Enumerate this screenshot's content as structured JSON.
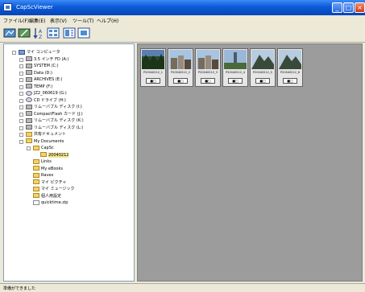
{
  "window": {
    "title": "CapScViewer"
  },
  "menu": [
    "ファイル(F)",
    "編集(E)",
    "表示(V)",
    "ツール(T)",
    "ヘルプ(H)"
  ],
  "toolbar": [
    {
      "icon": "view-icon"
    },
    {
      "icon": "edit-icon"
    },
    {
      "icon": "sort-icon"
    },
    {
      "icon": "thumbnail-view-icon"
    },
    {
      "icon": "list-view-icon"
    },
    {
      "icon": "slideshow-icon"
    }
  ],
  "tree": [
    {
      "label": "マイ コンピュータ",
      "icon": "comp",
      "expander": true
    },
    {
      "label": "3.5 インチ FD (A:)",
      "icon": "drive",
      "expander": true
    },
    {
      "label": "SYSTEM (C:)",
      "icon": "drive",
      "expander": true
    },
    {
      "label": "Data (D:)",
      "icon": "drive",
      "expander": true
    },
    {
      "label": "ARCHIVES (E:)",
      "icon": "drive",
      "expander": true
    },
    {
      "label": "TEMP (F:)",
      "icon": "drive",
      "expander": true
    },
    {
      "label": "JZ2_060619 (G:)",
      "icon": "cd",
      "expander": true
    },
    {
      "label": "CD ドライブ (H:)",
      "icon": "cd",
      "expander": true
    },
    {
      "label": "リムーバブル ディスク (I:)",
      "icon": "drive",
      "expander": true
    },
    {
      "label": "CompactFlash カード (J:)",
      "icon": "drive",
      "expander": true
    },
    {
      "label": "リムーバブル ディスク (K:)",
      "icon": "drive",
      "expander": true
    },
    {
      "label": "リムーバブル ディスク (L:)",
      "icon": "drive",
      "expander": true
    },
    {
      "label": "共有ドキュメント",
      "icon": "folder",
      "expander": true
    },
    {
      "label": "My Documents",
      "icon": "folder",
      "expander": true
    },
    {
      "label": "CapSc",
      "icon": "folder",
      "expander": true
    },
    {
      "label": "20040212",
      "icon": "folder",
      "expander": false,
      "selected": true
    },
    {
      "label": "Links",
      "icon": "folder",
      "expander": false
    },
    {
      "label": "My eBooks",
      "icon": "folder",
      "expander": false
    },
    {
      "label": "Ravex",
      "icon": "folder",
      "expander": false
    },
    {
      "label": "マイ ピクチャ",
      "icon": "folder",
      "expander": false
    },
    {
      "label": "マイ ミュージック",
      "icon": "folder",
      "expander": false
    },
    {
      "label": "個人用設定",
      "icon": "folder",
      "expander": false
    },
    {
      "label": "quicktime.zip",
      "icon": "file",
      "expander": false
    }
  ],
  "thumbnails": [
    {
      "filename": "P20040212_1",
      "buttons": "■□",
      "scene": "forest"
    },
    {
      "filename": "P20040212_2",
      "buttons": "■□",
      "scene": "town"
    },
    {
      "filename": "P20040212_3",
      "buttons": "■□",
      "scene": "town"
    },
    {
      "filename": "P20040212_4",
      "buttons": "■□",
      "scene": "tower"
    },
    {
      "filename": "P20040212_5",
      "buttons": "■□",
      "scene": "mountain"
    },
    {
      "filename": "P20040212_6",
      "buttons": "■□",
      "scene": "mountain"
    }
  ],
  "status": {
    "text": "準備ができました"
  },
  "colors": {
    "titlebar": "#0a5bd8",
    "thumb_pane": "#9c9c9c",
    "selection": "#f2e48a"
  }
}
